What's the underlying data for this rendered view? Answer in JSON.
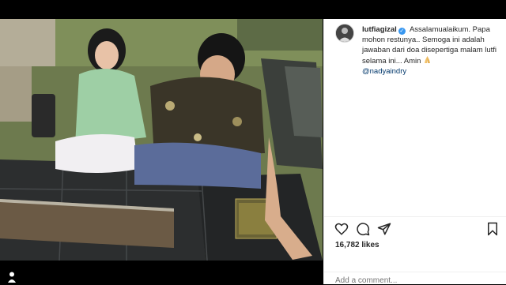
{
  "post": {
    "username": "lutfiagizal",
    "caption_text": "Assalamualaikum. Papa mohon restunya.. Semoga ini adalah jawaban dari doa disepertiga malam lutfi selama ini... Amin",
    "mention": "@nadyaindry",
    "likes": "16,782 likes",
    "comment_placeholder": "Add a comment..."
  },
  "icons": {
    "verified": "verified-badge-icon",
    "pray": "praying-hands-emoji",
    "like": "heart-icon",
    "comment": "comment-bubble-icon",
    "share": "paper-plane-icon",
    "save": "bookmark-icon",
    "profile": "person-icon"
  },
  "colors": {
    "verified": "#3897f0",
    "mention": "#00376b",
    "text": "#262626",
    "muted": "#8e8e8e"
  }
}
